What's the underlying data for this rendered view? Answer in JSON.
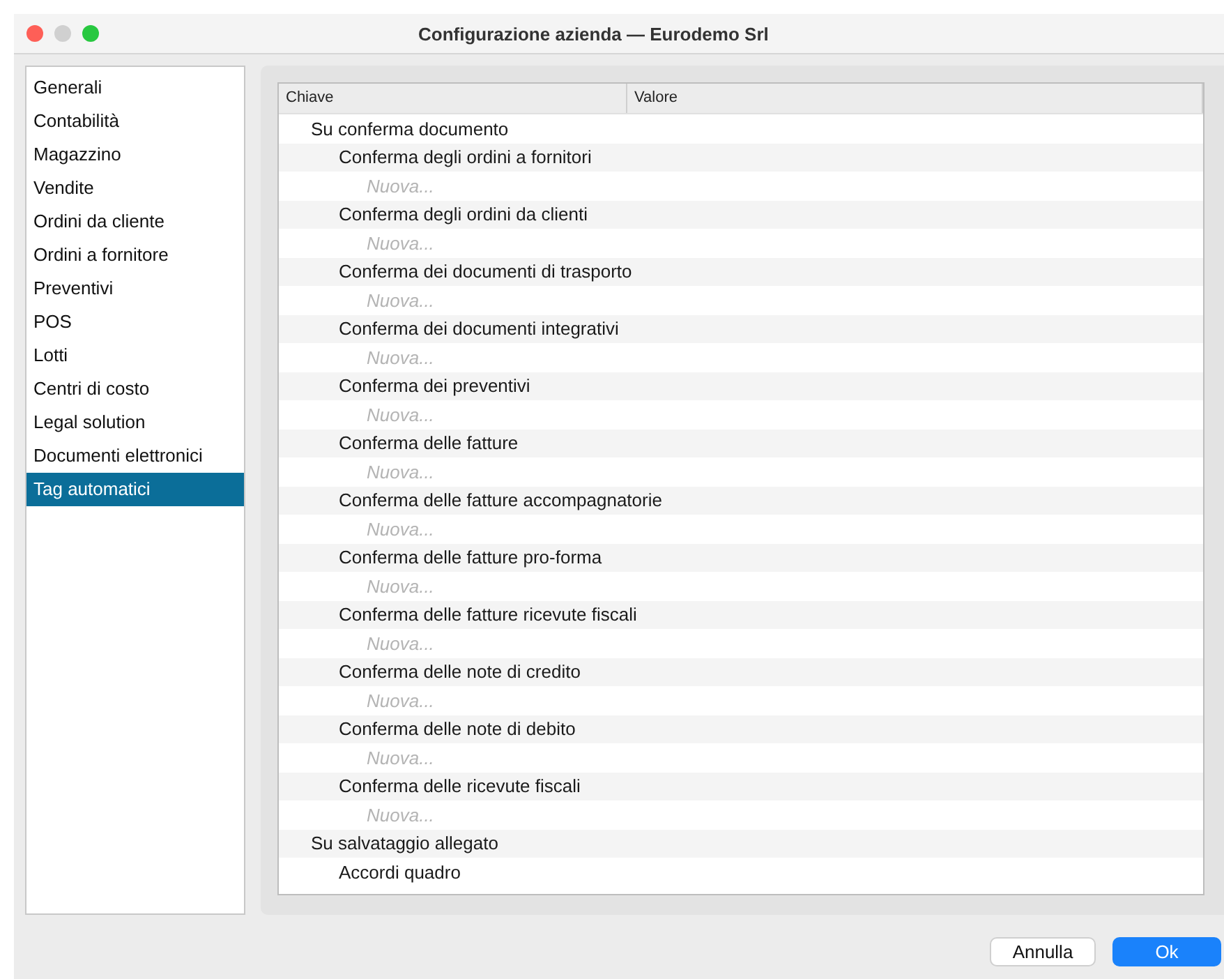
{
  "window": {
    "title": "Configurazione azienda — Eurodemo Srl"
  },
  "sidebar": {
    "items": [
      {
        "label": "Generali",
        "selected": false
      },
      {
        "label": "Contabilità",
        "selected": false
      },
      {
        "label": "Magazzino",
        "selected": false
      },
      {
        "label": "Vendite",
        "selected": false
      },
      {
        "label": "Ordini da cliente",
        "selected": false
      },
      {
        "label": "Ordini a fornitore",
        "selected": false
      },
      {
        "label": "Preventivi",
        "selected": false
      },
      {
        "label": "POS",
        "selected": false
      },
      {
        "label": "Lotti",
        "selected": false
      },
      {
        "label": "Centri di costo",
        "selected": false
      },
      {
        "label": "Legal solution",
        "selected": false
      },
      {
        "label": "Documenti elettronici",
        "selected": false
      },
      {
        "label": "Tag automatici",
        "selected": true
      }
    ]
  },
  "table": {
    "columns": [
      "Chiave",
      "Valore"
    ],
    "tree": [
      {
        "label": "Su conferma documento",
        "children": [
          {
            "label": "Conferma degli ordini a fornitori",
            "children": [
              {
                "placeholder": "Nuova..."
              }
            ]
          },
          {
            "label": "Conferma degli ordini da clienti",
            "children": [
              {
                "placeholder": "Nuova..."
              }
            ]
          },
          {
            "label": "Conferma dei documenti di trasporto",
            "children": [
              {
                "placeholder": "Nuova..."
              }
            ]
          },
          {
            "label": "Conferma dei documenti integrativi",
            "children": [
              {
                "placeholder": "Nuova..."
              }
            ]
          },
          {
            "label": "Conferma dei preventivi",
            "children": [
              {
                "placeholder": "Nuova..."
              }
            ]
          },
          {
            "label": "Conferma delle fatture",
            "children": [
              {
                "placeholder": "Nuova..."
              }
            ]
          },
          {
            "label": "Conferma delle fatture accompagnatorie",
            "children": [
              {
                "placeholder": "Nuova..."
              }
            ]
          },
          {
            "label": "Conferma delle fatture pro-forma",
            "children": [
              {
                "placeholder": "Nuova..."
              }
            ]
          },
          {
            "label": "Conferma delle fatture ricevute fiscali",
            "children": [
              {
                "placeholder": "Nuova..."
              }
            ]
          },
          {
            "label": "Conferma delle note di credito",
            "children": [
              {
                "placeholder": "Nuova..."
              }
            ]
          },
          {
            "label": "Conferma delle note di debito",
            "children": [
              {
                "placeholder": "Nuova..."
              }
            ]
          },
          {
            "label": "Conferma delle ricevute fiscali",
            "children": [
              {
                "placeholder": "Nuova..."
              }
            ]
          }
        ]
      },
      {
        "label": "Su salvataggio allegato",
        "children": [
          {
            "label": "Accordi quadro"
          }
        ]
      }
    ]
  },
  "buttons": [
    {
      "label": "Annulla",
      "kind": "secondary"
    },
    {
      "label": "Ok",
      "kind": "primary"
    }
  ]
}
